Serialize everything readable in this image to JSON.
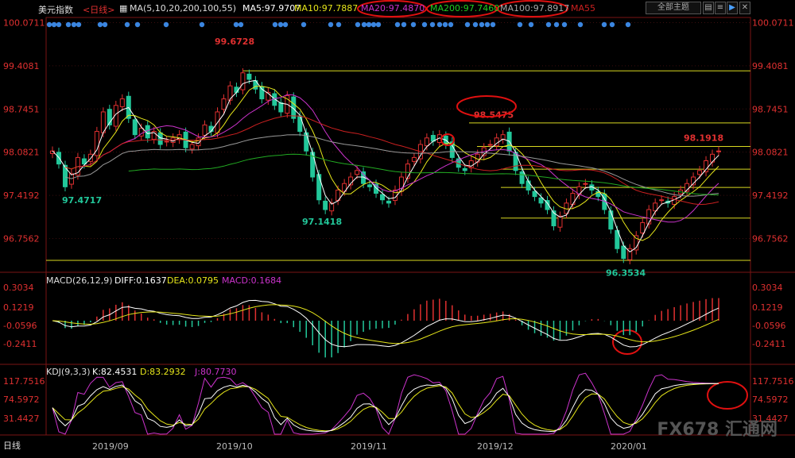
{
  "header": {
    "symbol": "美元指数",
    "period": "<日线>",
    "ma_title": "MA(5,10,20,200,100,55)",
    "ma5": "MA5:97.9707",
    "ma10": "MA10:97.7887",
    "ma20": "MA20:97.4870",
    "ma200": "MA200:97.7460",
    "ma100": "MA100:97.8917",
    "ma55": "MA55",
    "theme_button": "全部主题",
    "period_bottom": "日线"
  },
  "colors": {
    "up": "#e03030",
    "down": "#22c79a",
    "ma5": "#ffffff",
    "ma10": "#e6e61a",
    "ma20": "#cc33cc",
    "ma200": "#22aa22",
    "ma55": "#cc2020",
    "ma100": "#999999",
    "level": "#d8d820",
    "circle": "#e01010"
  },
  "price_axis": {
    "ticks": [
      "100.0711",
      "99.4081",
      "98.7451",
      "98.0821",
      "97.4192",
      "96.7562"
    ],
    "annotations": [
      "99.6728",
      "97.4717",
      "97.1418",
      "98.5475",
      "98.1918",
      "96.3534"
    ]
  },
  "macd": {
    "title": "MACD(26,12,9)",
    "diff": "DIFF:0.1637",
    "dea": "DEA:0.0795",
    "macd": "MACD:0.1684",
    "ticks": [
      "0.3034",
      "0.1219",
      "-0.0596",
      "-0.2411"
    ]
  },
  "kdj": {
    "title": "KDJ(9,3,3)",
    "k": "K:82.4531",
    "d": "D:83.2932",
    "j": "J:80.7730",
    "ticks": [
      "117.7516",
      "74.5972",
      "31.4427"
    ]
  },
  "months": [
    "2019/09",
    "2019/10",
    "2019/11",
    "2019/12",
    "2020/01"
  ],
  "watermark": "FX678 汇通网",
  "chart_data": {
    "type": "candlestick",
    "title": "美元指数 日线",
    "y_ticks": [
      100.0711,
      99.4081,
      98.7451,
      98.0821,
      97.4192,
      96.7562
    ],
    "ylim": [
      96.25,
      100.15
    ],
    "annotated_points": [
      {
        "label": "99.6728",
        "value": 99.6728
      },
      {
        "label": "97.4717",
        "value": 97.4717
      },
      {
        "label": "97.1418",
        "value": 97.1418
      },
      {
        "label": "98.5475",
        "value": 98.5475
      },
      {
        "label": "98.1918",
        "value": 98.1918
      },
      {
        "label": "96.3534",
        "value": 96.3534
      }
    ],
    "horizontal_levels": [
      99.33,
      98.53,
      98.17,
      97.82,
      97.54,
      97.07,
      96.42
    ],
    "closes": [
      98.1,
      97.9,
      97.55,
      97.75,
      98.0,
      97.9,
      98.05,
      98.4,
      98.7,
      98.5,
      98.8,
      98.9,
      98.6,
      98.35,
      98.45,
      98.3,
      98.4,
      98.2,
      98.25,
      98.3,
      98.35,
      98.15,
      98.2,
      98.3,
      98.5,
      98.4,
      98.7,
      98.9,
      99.1,
      99.0,
      99.3,
      99.2,
      99.05,
      98.9,
      99.0,
      98.8,
      98.7,
      98.95,
      98.6,
      98.4,
      98.1,
      97.7,
      97.35,
      97.2,
      97.3,
      97.5,
      97.6,
      97.7,
      97.8,
      97.6,
      97.55,
      97.45,
      97.35,
      97.3,
      97.5,
      97.7,
      97.9,
      98.0,
      98.2,
      98.3,
      98.25,
      98.35,
      98.2,
      98.0,
      97.85,
      97.8,
      97.95,
      98.05,
      98.15,
      98.2,
      98.3,
      98.35,
      98.1,
      97.8,
      97.6,
      97.5,
      97.4,
      97.3,
      97.2,
      96.95,
      97.1,
      97.3,
      97.45,
      97.55,
      97.6,
      97.5,
      97.4,
      97.2,
      96.9,
      96.6,
      96.45,
      96.6,
      96.8,
      97.0,
      97.2,
      97.3,
      97.35,
      97.3,
      97.4,
      97.5,
      97.6,
      97.7,
      97.8,
      97.95,
      98.05,
      98.1
    ]
  }
}
